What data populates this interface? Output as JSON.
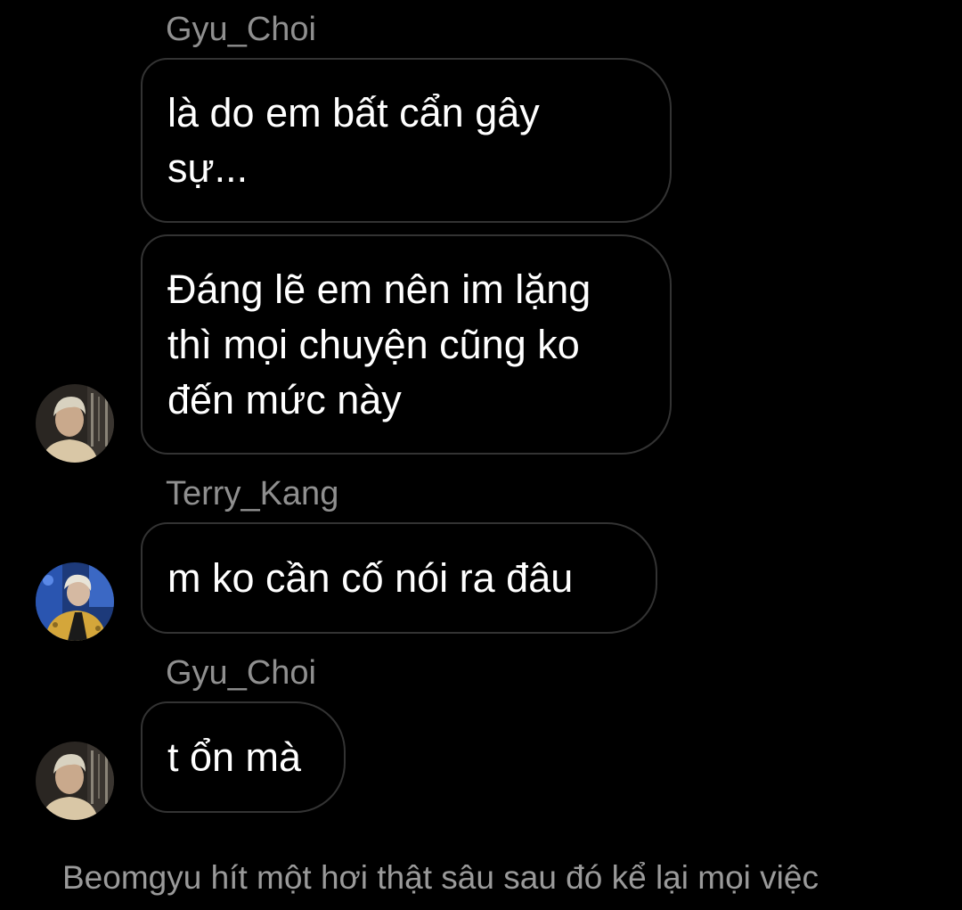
{
  "chat": {
    "messages": [
      {
        "sender": "Gyu_Choi",
        "text": "là do em bất cẩn gây sự..."
      },
      {
        "text": "Đáng lẽ em nên im lặng thì mọi chuyện cũng ko đến mức này"
      },
      {
        "sender": "Terry_Kang",
        "text": "m ko cần cố nói ra đâu"
      },
      {
        "sender": "Gyu_Choi",
        "text": "t ổn mà"
      }
    ],
    "avatars": [
      {
        "name": "Gyu_Choi",
        "icon": "avatar-photo"
      },
      {
        "name": "Terry_Kang",
        "icon": "avatar-photo"
      },
      {
        "name": "Gyu_Choi",
        "icon": "avatar-photo"
      }
    ]
  },
  "narration": "Beomgyu hít một hơi thật sâu sau đó kể lại mọi việc",
  "colors": {
    "background": "#000000",
    "bubble_border": "#333333",
    "sender_name": "#8f8f8f",
    "message_text": "#ffffff",
    "narration_text": "#9a9a9a"
  }
}
